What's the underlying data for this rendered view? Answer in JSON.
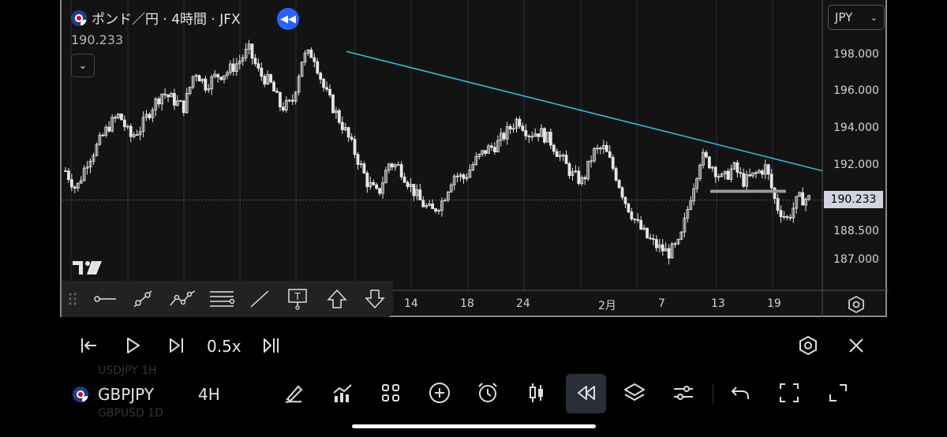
{
  "symbol_title": "ポンド／円 · 4時間 · JFX",
  "current_price_label": "190.233",
  "currency_select": "JPY",
  "y_axis_labels": [
    "198.000",
    "196.000",
    "194.000",
    "192.000",
    "188.500",
    "187.000"
  ],
  "last_price_badge": "190.233",
  "x_axis_labels": [
    "14",
    "18",
    "24",
    "2月",
    "7",
    "13",
    "19"
  ],
  "replay": {
    "speed": "0.5x"
  },
  "bottom": {
    "symbol": "GBPJPY",
    "timeframe": "4H",
    "ghost_above": "USDJPY 1H",
    "ghost_below": "GBPUSD 1D"
  },
  "colors": {
    "background": "#131313",
    "candle": "#e6e6e6",
    "trendline": "#29c7e6",
    "accent": "#2962ff"
  },
  "chart_data": {
    "type": "candlestick",
    "title": "ポンド／円 · 4時間 · JFX",
    "ylim": [
      186.0,
      199.0
    ],
    "y_ticks": [
      198.0,
      196.0,
      194.0,
      192.0,
      188.5,
      187.0
    ],
    "x_ticks": [
      "14",
      "18",
      "24",
      "2月",
      "7",
      "13",
      "19"
    ],
    "last_price": 190.233,
    "trendline": {
      "from": 198.2,
      "to": 191.8,
      "color": "#29c7e6"
    },
    "horizontal_level": 190.7,
    "close_path": [
      191.8,
      190.8,
      192.3,
      193.2,
      194.2,
      194.8,
      193.6,
      194.1,
      195.2,
      196.0,
      195.6,
      195.2,
      197.2,
      196.4,
      196.9,
      197.1,
      197.6,
      198.3,
      197.0,
      196.5,
      195.2,
      195.4,
      197.9,
      198.1,
      196.2,
      195.0,
      193.9,
      192.6,
      191.2,
      190.5,
      192.2,
      192.0,
      191.0,
      190.1,
      189.6,
      190.2,
      191.6,
      191.4,
      192.3,
      192.9,
      193.2,
      193.9,
      194.6,
      193.8,
      193.9,
      193.4,
      192.5,
      191.6,
      191.2,
      192.8,
      193.0,
      191.7,
      190.1,
      189.0,
      188.2,
      187.7,
      187.4,
      187.9,
      190.4,
      192.6,
      192.1,
      191.3,
      192.0,
      191.2,
      191.6,
      192.0,
      189.9,
      189.2,
      190.3,
      190.3
    ]
  }
}
